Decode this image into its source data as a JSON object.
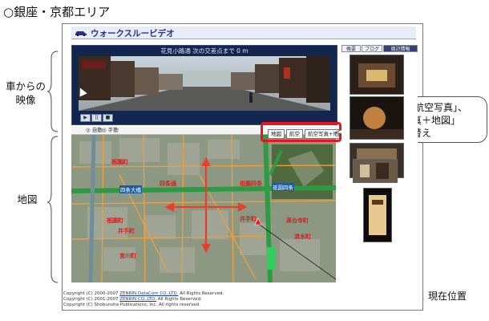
{
  "page_heading": "○銀座・京都エリア",
  "labels": {
    "video_label": "車からの\n映像",
    "map_label": "地図",
    "current_position_label": "現在位置"
  },
  "callout": {
    "text": "「地図」、「航空写真」、\n「航空写真＋地図」\n切替え"
  },
  "app": {
    "title": "ウォークスルービデオ",
    "video_header": "花見小路通  次の交差点まで 0 m",
    "video_controls": [
      "▶",
      "||",
      "■"
    ],
    "map_toolbar": [
      "◎ 自動",
      "◎ 手動"
    ],
    "map_switch_buttons": [
      "地図",
      "航空",
      "航空写真+地図"
    ],
    "right_tabs": [
      "概要",
      "ブログ",
      "周辺情報"
    ],
    "map_place_labels": [
      "祇園町",
      "祇園町",
      "四条大橋",
      "祇園四条",
      "井手町",
      "井手町",
      "清水町",
      "宮川町",
      "高台寺町",
      "四条通",
      "祇園四条"
    ]
  },
  "copyright": {
    "line1_prefix": "Copyright (C) 2000-2007 ",
    "line1_link": "ZENRIN DataCom CO.,LTD.",
    "line1_suffix": " All Rights Reserved.",
    "line2_prefix": "Copyright (C) 2001-2007 ",
    "line2_link": "ZENRIN CO.,LTD.",
    "line2_suffix": " All Rights Reserved.",
    "line3": "Copyright (C) Shobunsha Publications, Inc. All rights reserved."
  },
  "colors": {
    "highlight_red": "#e8141e",
    "banner_blue": "#2a2f8a",
    "video_bg": "#13264f"
  }
}
